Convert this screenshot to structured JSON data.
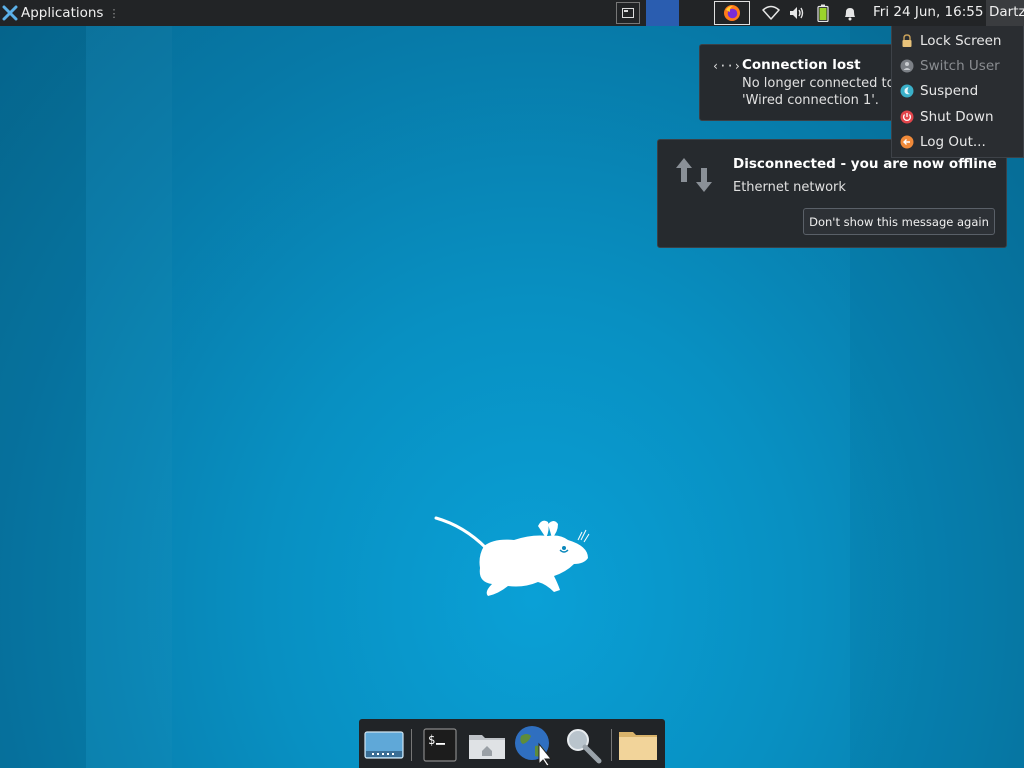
{
  "panel": {
    "applications_label": "Applications",
    "clock": "Fri 24 Jun, 16:55",
    "user": "Dartz",
    "tray_icons": [
      "network-wifi-icon",
      "volume-icon",
      "battery-icon",
      "notification-bell-icon"
    ]
  },
  "notifications": {
    "connection_lost": {
      "title": "Connection lost",
      "line1": "No longer connected to",
      "line2": "'Wired connection 1'."
    },
    "disconnected": {
      "title": "Disconnected - you are now offline",
      "body": "Ethernet network",
      "button": "Don't show this message again"
    }
  },
  "action_menu": {
    "items": [
      {
        "label": "Lock Screen",
        "icon": "lock-icon",
        "enabled": true
      },
      {
        "label": "Switch User",
        "icon": "switch-user-icon",
        "enabled": false
      },
      {
        "label": "Suspend",
        "icon": "suspend-icon",
        "enabled": true
      },
      {
        "label": "Shut Down",
        "icon": "power-icon",
        "enabled": true
      },
      {
        "label": "Log Out...",
        "icon": "logout-icon",
        "enabled": true
      }
    ]
  },
  "dock": {
    "items": [
      "show-desktop-icon",
      "terminal-icon",
      "home-folder-icon",
      "web-browser-icon",
      "app-finder-icon",
      "file-manager-icon"
    ]
  },
  "colors": {
    "panel_bg": "#222426",
    "desktop_blue": "#0890c2",
    "workspace_active": "#2a5db0"
  }
}
